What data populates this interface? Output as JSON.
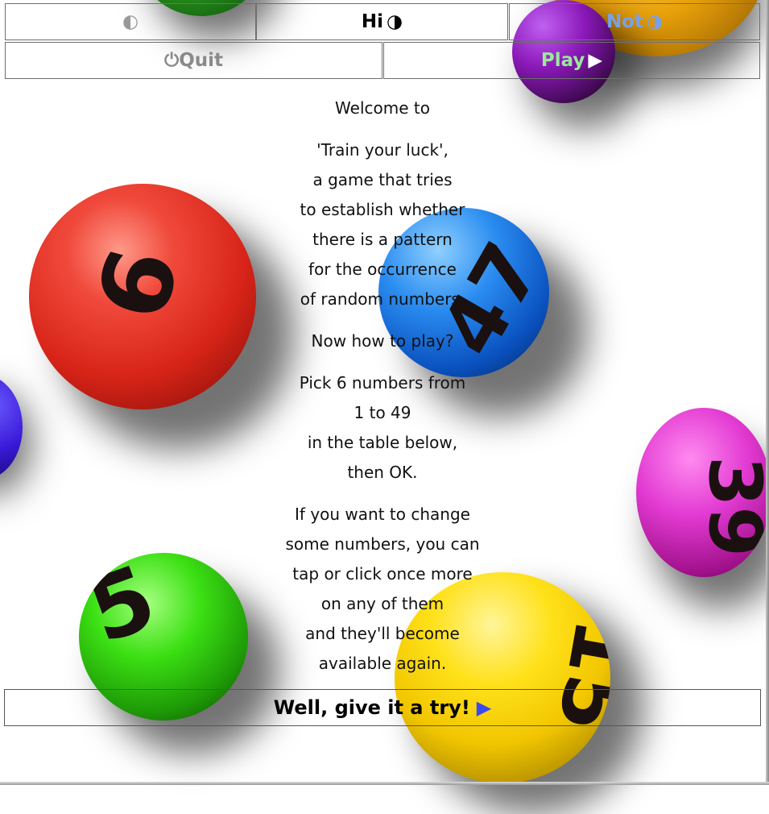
{
  "header": {
    "contrast_blank": "◐",
    "hi_label": "Hi",
    "hi_icon": "◑",
    "not_label": "Not",
    "not_icon": "◑",
    "quit_label": "Quit",
    "quit_icon": "⏻",
    "play_label": "Play",
    "play_icon": "▶"
  },
  "intro": {
    "welcome": "Welcome to",
    "lines1": [
      "'Train your luck',",
      "a game that tries",
      "to establish whether",
      "there is a pattern",
      "for the occurrence",
      "of random numbers."
    ],
    "howto": "Now how to play?",
    "lines2": [
      "Pick 6 numbers from",
      "1 to 49",
      "in the table below,",
      "then OK."
    ],
    "lines3": [
      "If you want to change",
      "some numbers, you can",
      "tap or click once more",
      "on any of them",
      "and they'll become",
      "available again."
    ]
  },
  "cta": {
    "label": "Well, give it a try!",
    "icon": "▶"
  },
  "balls": [
    {
      "name": "red-ball",
      "number": "6",
      "color": "#e02a20"
    },
    {
      "name": "blue-ball",
      "number": "47",
      "color": "#1467d8"
    },
    {
      "name": "magenta-ball",
      "number": "39",
      "color": "#d21bb8"
    },
    {
      "name": "green-ball",
      "number": "5",
      "color": "#2ec80a"
    },
    {
      "name": "yellow-ball",
      "number": "15",
      "color": "#f1c600"
    },
    {
      "name": "orange-ball",
      "number": "",
      "color": "#e8a10a"
    },
    {
      "name": "purple-ball",
      "number": "",
      "color": "#8a18b8"
    },
    {
      "name": "indigo-ball",
      "number": "",
      "color": "#3a1ad8"
    },
    {
      "name": "green-top-ball",
      "number": "",
      "color": "#2a9a20"
    }
  ]
}
